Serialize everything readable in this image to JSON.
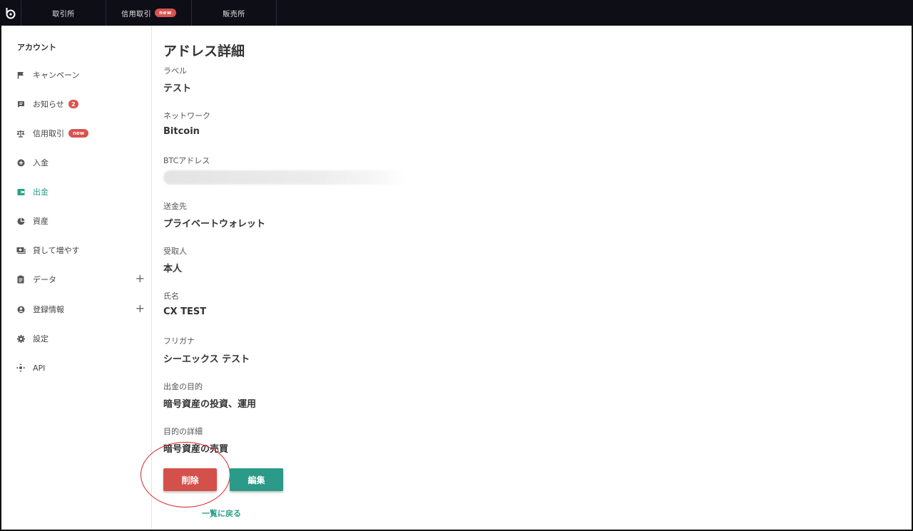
{
  "topnav": {
    "tabs": [
      {
        "label": "取引所"
      },
      {
        "label": "信用取引",
        "badge": "new"
      },
      {
        "label": "販売所"
      }
    ]
  },
  "sidebar": {
    "title": "アカウント",
    "items": [
      {
        "label": "キャンペーン",
        "icon": "flag-icon"
      },
      {
        "label": "お知らせ",
        "icon": "message-icon",
        "count": "2"
      },
      {
        "label": "信用取引",
        "icon": "scale-icon",
        "badge": "new"
      },
      {
        "label": "入金",
        "icon": "plus-circle-icon"
      },
      {
        "label": "出金",
        "icon": "wallet-icon",
        "active": true
      },
      {
        "label": "資産",
        "icon": "pie-chart-icon"
      },
      {
        "label": "貸して増やす",
        "icon": "cash-icon"
      },
      {
        "label": "データ",
        "icon": "clipboard-icon",
        "expand": "+"
      },
      {
        "label": "登録情報",
        "icon": "account-circle-icon",
        "expand": "+"
      },
      {
        "label": "設定",
        "icon": "gear-icon"
      },
      {
        "label": "API",
        "icon": "api-icon"
      }
    ]
  },
  "main": {
    "title": "アドレス詳細",
    "fields": {
      "label": {
        "label": "ラベル",
        "value": "テスト"
      },
      "network": {
        "label": "ネットワーク",
        "value": "Bitcoin"
      },
      "address": {
        "label": "BTCアドレス",
        "value": ""
      },
      "destination": {
        "label": "送金先",
        "value": "プライベートウォレット"
      },
      "recipient": {
        "label": "受取人",
        "value": "本人"
      },
      "name": {
        "label": "氏名",
        "value": "CX TEST"
      },
      "furigana": {
        "label": "フリガナ",
        "value": "シーエックス テスト"
      },
      "purpose": {
        "label": "出金の目的",
        "value": "暗号資産の投資、運用"
      },
      "purpose_detail": {
        "label": "目的の詳細",
        "value": "暗号資産の売買"
      }
    },
    "delete_button": "削除",
    "edit_button": "編集",
    "back_link": "一覧に戻る"
  },
  "colors": {
    "topbar": "#0e0e17",
    "accent": "#28a08a",
    "danger": "#d4504a",
    "edit": "#2b9a88",
    "annotation": "#e02020"
  }
}
